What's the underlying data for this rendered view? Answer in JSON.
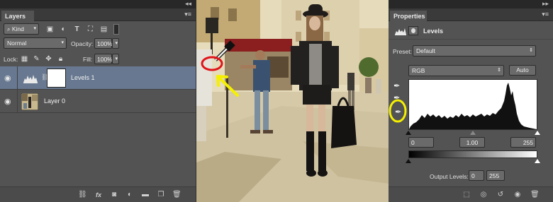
{
  "layers_panel": {
    "tab_label": "Layers",
    "filter_kind": "Kind",
    "blend_mode": "Normal",
    "opacity_label": "Opacity:",
    "opacity_value": "100%",
    "lock_label": "Lock:",
    "fill_label": "Fill:",
    "fill_value": "100%",
    "layers": [
      {
        "name": "Levels 1",
        "selected": true
      },
      {
        "name": "Layer 0",
        "selected": false
      }
    ],
    "bottom_icons": [
      "link-icon",
      "fx-icon",
      "add-mask-icon",
      "adjustment-layer-icon",
      "folder-icon",
      "new-layer-icon",
      "trash-icon"
    ]
  },
  "properties_panel": {
    "tab_label": "Properties",
    "adjustment_name": "Levels",
    "preset_label": "Preset:",
    "preset_value": "Default",
    "channel_value": "RGB",
    "auto_label": "Auto",
    "input_black": "0",
    "input_gamma": "1.00",
    "input_white": "255",
    "output_label": "Output Levels:",
    "output_black": "0",
    "output_white": "255"
  },
  "colors": {
    "panel_bg": "#535353",
    "selected_layer": "#677890",
    "annotation_yellow": "#f5f000",
    "annotation_red": "#e0141a"
  }
}
